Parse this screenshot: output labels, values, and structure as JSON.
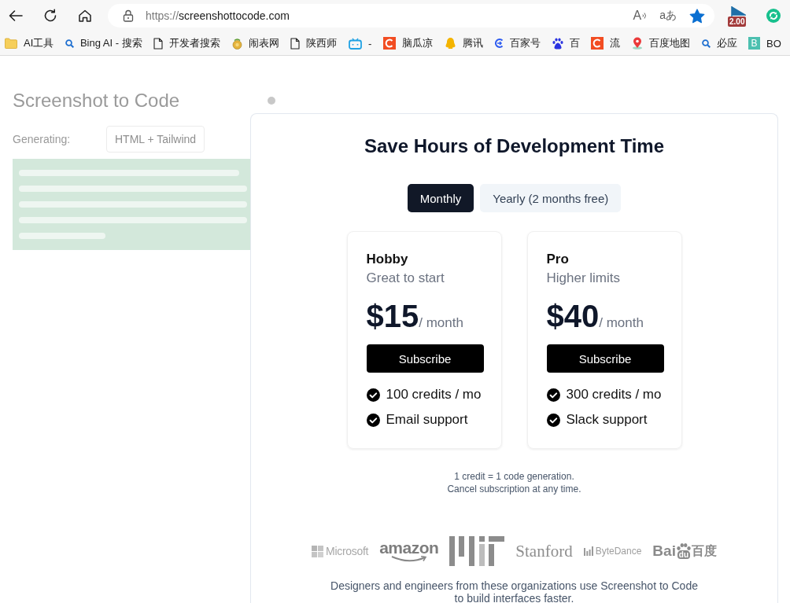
{
  "browser": {
    "url_scheme": "https://",
    "url_rest": "screenshottocode.com",
    "read_aloud_glyph": "A",
    "translate_glyph": "aあ",
    "favorite": true,
    "extension_badge": "2.00"
  },
  "bookmarks": [
    {
      "kind": "folder",
      "label": "AI工具"
    },
    {
      "kind": "search",
      "label": "Bing AI - 搜索"
    },
    {
      "kind": "page",
      "label": "开发者搜索"
    },
    {
      "kind": "pot",
      "label": "闹表网"
    },
    {
      "kind": "page",
      "label": "陕西师"
    },
    {
      "kind": "tv",
      "label": "-"
    },
    {
      "kind": "arc-tile",
      "label": "脑瓜凉"
    },
    {
      "kind": "penguin",
      "label": "腾讯"
    },
    {
      "kind": "swirl",
      "label": "百家号"
    },
    {
      "kind": "paw",
      "label": "百"
    },
    {
      "kind": "arc-tile",
      "label": "流"
    },
    {
      "kind": "pin",
      "label": "百度地图"
    },
    {
      "kind": "search",
      "label": "必应"
    },
    {
      "kind": "letter-tile",
      "badge": "B",
      "label": "BO"
    }
  ],
  "background": {
    "title": "Screenshot to Code",
    "generating_label": "Generating:",
    "stack": "HTML + Tailwind"
  },
  "modal": {
    "title": "Save Hours of Development Time",
    "billing_tabs": [
      {
        "label": "Monthly",
        "selected": true
      },
      {
        "label": "Yearly (2 months free)",
        "selected": false
      }
    ],
    "plans": [
      {
        "name": "Hobby",
        "tagline": "Great to start",
        "price": "$15",
        "period": "/ month",
        "button": "Subscribe",
        "features": [
          "100 credits / mo",
          "Email support"
        ]
      },
      {
        "name": "Pro",
        "tagline": "Higher limits",
        "price": "$40",
        "period": "/ month",
        "button": "Subscribe",
        "features": [
          "300 credits / mo",
          "Slack support"
        ]
      }
    ],
    "notes": [
      "1 credit = 1 code generation.",
      "Cancel subscription at any time."
    ],
    "logos": [
      {
        "kind": "squares",
        "text": "Microsoft"
      },
      {
        "kind": "smile",
        "text": "amazon"
      },
      {
        "kind": "bars"
      },
      {
        "kind": "serif",
        "text": "Stanford"
      },
      {
        "kind": "equalizer",
        "text": "ByteDance"
      },
      {
        "kind": "paw",
        "text": "Bai",
        "pad_text": "du",
        "text_after": "百度"
      }
    ],
    "closing": "Designers and engineers from these organizations use Screenshot to Code to build interfaces faster."
  }
}
